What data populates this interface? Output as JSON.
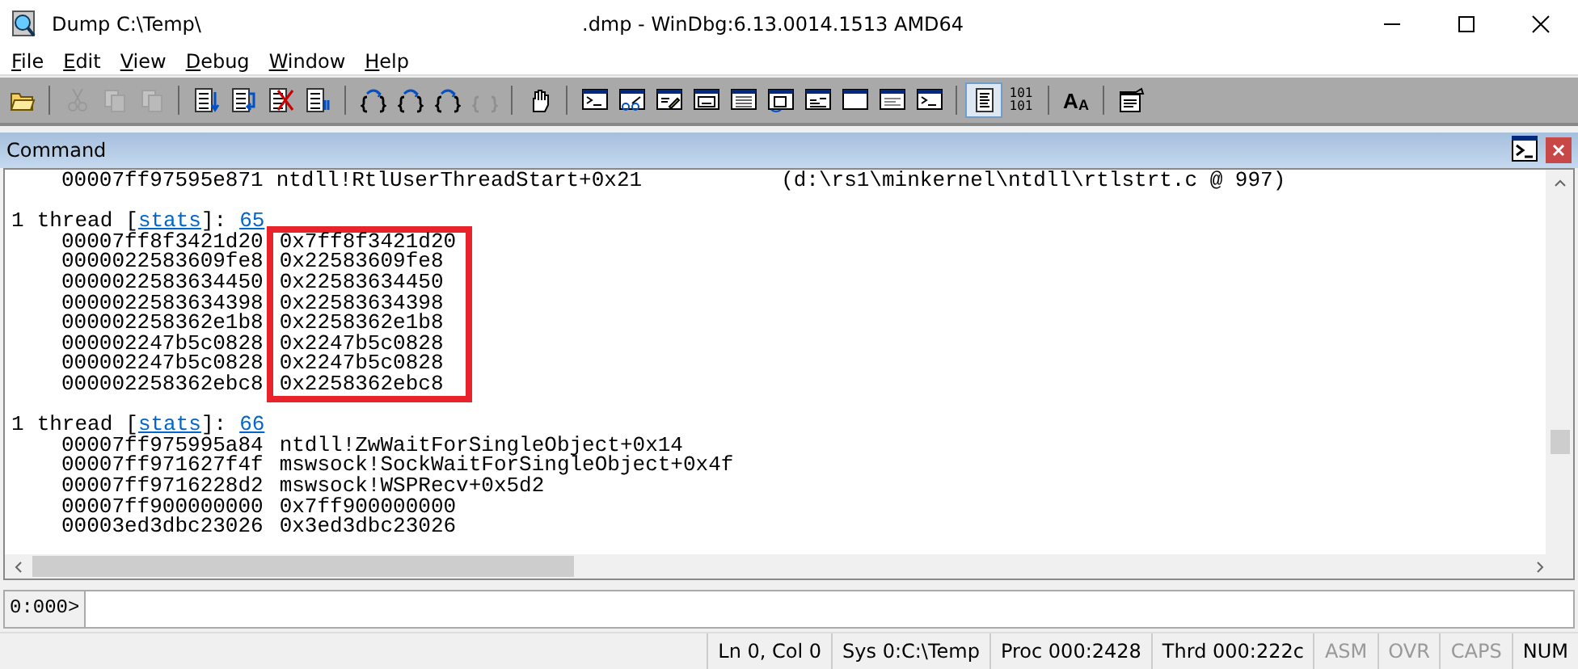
{
  "window": {
    "title": "Dump C:\\Temp\\",
    "title_suffix": ".dmp - WinDbg:6.13.0014.1513 AMD64"
  },
  "menu": [
    "File",
    "Edit",
    "View",
    "Debug",
    "Window",
    "Help"
  ],
  "toolbar": [
    [
      {
        "kind": "open",
        "disabled": false,
        "selected": false
      }
    ],
    [
      {
        "kind": "cut",
        "disabled": true,
        "selected": false
      },
      {
        "kind": "copy",
        "disabled": true,
        "selected": false
      },
      {
        "kind": "paste",
        "disabled": true,
        "selected": false
      }
    ],
    [
      {
        "kind": "list-down",
        "disabled": false,
        "selected": false
      },
      {
        "kind": "list-loop",
        "disabled": false,
        "selected": false
      },
      {
        "kind": "list-cross",
        "disabled": false,
        "selected": false
      },
      {
        "kind": "list-bars",
        "disabled": false,
        "selected": false
      }
    ],
    [
      {
        "kind": "braces-in",
        "disabled": false,
        "selected": false
      },
      {
        "kind": "braces-over",
        "disabled": false,
        "selected": false
      },
      {
        "kind": "braces-out",
        "disabled": false,
        "selected": false
      },
      {
        "kind": "braces-back",
        "disabled": true,
        "selected": false
      }
    ],
    [
      {
        "kind": "hand",
        "disabled": false,
        "selected": false
      }
    ],
    [
      {
        "kind": "win-prompt",
        "disabled": false,
        "selected": false
      },
      {
        "kind": "win-glasses",
        "disabled": false,
        "selected": false
      },
      {
        "kind": "win-pencil",
        "disabled": false,
        "selected": false
      },
      {
        "kind": "win-ox",
        "disabled": false,
        "selected": false
      },
      {
        "kind": "win-list",
        "disabled": false,
        "selected": false
      },
      {
        "kind": "win-stack",
        "disabled": false,
        "selected": false
      },
      {
        "kind": "win-code",
        "disabled": false,
        "selected": false
      },
      {
        "kind": "win-blank",
        "disabled": false,
        "selected": false
      },
      {
        "kind": "win-lines",
        "disabled": false,
        "selected": false
      },
      {
        "kind": "win-prompt2",
        "disabled": false,
        "selected": false
      }
    ],
    [
      {
        "kind": "page",
        "disabled": false,
        "selected": true
      },
      {
        "kind": "text",
        "label": "101\n101",
        "disabled": false,
        "selected": false
      }
    ],
    [
      {
        "kind": "font",
        "label": "A",
        "label_small": "A",
        "disabled": false,
        "selected": false
      }
    ],
    [
      {
        "kind": "options",
        "disabled": false,
        "selected": false
      }
    ]
  ],
  "command_pane": {
    "title": "Command",
    "lines": [
      {
        "kind": "frame",
        "address": "00007ff97595e871",
        "symbol": "ntdll!RtlUserThreadStart+0x21",
        "source": "(d:\\rs1\\minkernel\\ntdll\\rtlstrt.c @ 997)"
      },
      {
        "kind": "blank"
      },
      {
        "kind": "group",
        "count": "1",
        "word": "thread",
        "open": "[",
        "link": "stats",
        "close": "]:",
        "id": "65",
        "highlighted": true,
        "frames": [
          {
            "address": "00007ff8f3421d20",
            "symbol": "0x7ff8f3421d20"
          },
          {
            "address": "0000022583609fe8",
            "symbol": "0x22583609fe8"
          },
          {
            "address": "0000022583634450",
            "symbol": "0x22583634450"
          },
          {
            "address": "0000022583634398",
            "symbol": "0x22583634398"
          },
          {
            "address": "000002258362e1b8",
            "symbol": "0x2258362e1b8"
          },
          {
            "address": "000002247b5c0828",
            "symbol": "0x2247b5c0828"
          },
          {
            "address": "000002247b5c0828",
            "symbol": "0x2247b5c0828"
          },
          {
            "address": "000002258362ebc8",
            "symbol": "0x2258362ebc8"
          }
        ]
      },
      {
        "kind": "blank"
      },
      {
        "kind": "group",
        "count": "1",
        "word": "thread",
        "open": "[",
        "link": "stats",
        "close": "]:",
        "id": "66",
        "highlighted": false,
        "frames": [
          {
            "address": "00007ff975995a84",
            "symbol": "ntdll!ZwWaitForSingleObject+0x14"
          },
          {
            "address": "00007ff971627f4f",
            "symbol": "mswsock!SockWaitForSingleObject+0x4f"
          },
          {
            "address": "00007ff9716228d2",
            "symbol": "mswsock!WSPRecv+0x5d2"
          },
          {
            "address": "00007ff900000000",
            "symbol": "0x7ff900000000"
          },
          {
            "address": "00003ed3dbc23026",
            "symbol": "0x3ed3dbc23026"
          }
        ]
      }
    ],
    "prompt": "0:000>"
  },
  "status_bar": [
    {
      "text": "Ln 0, Col 0",
      "disabled": false
    },
    {
      "text": "Sys 0:C:\\Temp",
      "disabled": false
    },
    {
      "text": "Proc 000:2428",
      "disabled": false
    },
    {
      "text": "Thrd 000:222c",
      "disabled": false
    },
    {
      "text": "ASM",
      "disabled": true
    },
    {
      "text": "OVR",
      "disabled": true
    },
    {
      "text": "CAPS",
      "disabled": true
    },
    {
      "text": "NUM",
      "disabled": false
    }
  ]
}
